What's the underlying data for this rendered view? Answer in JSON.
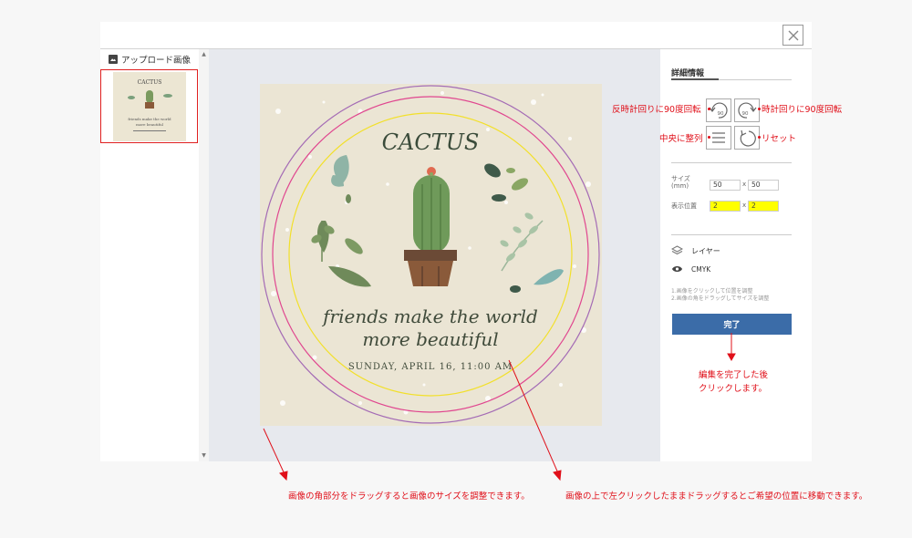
{
  "left_panel": {
    "title": "アップロード画像"
  },
  "design": {
    "title": "CACTUS",
    "tagline_1": "friends make the world",
    "tagline_2": "more beautiful",
    "date_line": "SUNDAY, APRIL 16, 11:00 AM"
  },
  "thumb": {
    "title": "CACTUS",
    "line1": "friends make the world",
    "line2": "more beautiful"
  },
  "right_panel": {
    "tab_label": "詳細情報",
    "rotate_ccw_value": "90",
    "rotate_cw_value": "90",
    "size_label_1": "サイズ",
    "size_label_2": "(mm)",
    "size_w": "50",
    "size_h": "50",
    "position_label": "表示位置",
    "pos_x": "2",
    "pos_y": "2",
    "x_sep": "x",
    "layer_label": "レイヤー",
    "cmyk_label": "CMYK",
    "note_1": "1.画像をクリックして位置を調整",
    "note_2": "2.画像の角をドラッグしてサイズを調整",
    "done_label": "完了"
  },
  "annotations": {
    "rotate_ccw": "反時計回りに90度回転",
    "rotate_cw": "時計回りに90度回転",
    "center_align": "中央に整列",
    "reset": "リセット",
    "done_note_1": "編集を完了した後",
    "done_note_2": "クリックします。",
    "resize_hint": "画像の角部分をドラッグすると画像のサイズを調整できます。",
    "move_hint": "画像の上で左クリックしたままドラッグするとご希望の位置に移動できます。"
  },
  "colors": {
    "accent_red": "#e0101a",
    "button_blue": "#3b6ca8",
    "highlight_yellow": "#ffff00",
    "cream": "#ebe5d4"
  }
}
